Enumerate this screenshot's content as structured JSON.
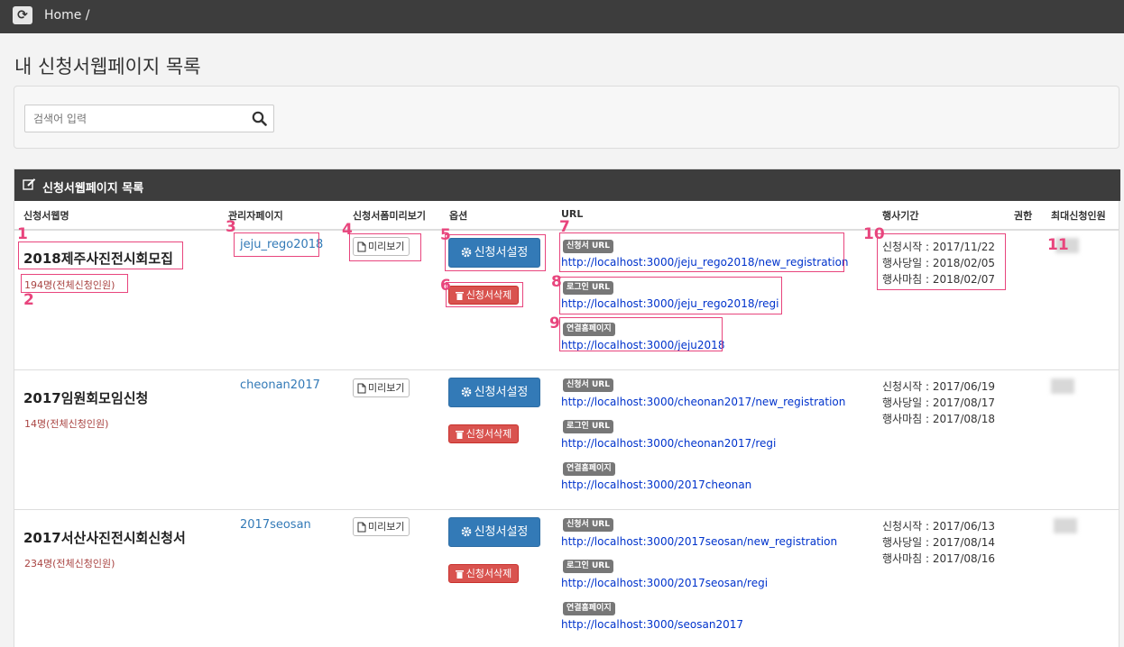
{
  "topbar": {
    "breadcrumb": "Home /",
    "refresh_glyph": "⟳"
  },
  "page": {
    "title": "내 신청서웹페이지 목록"
  },
  "search": {
    "placeholder": "검색어 입력"
  },
  "panel": {
    "title": "신청서웹페이지 목록"
  },
  "columns": {
    "name": "신청서웹명",
    "admin": "관리자페이지",
    "preview": "신청서폼미리보기",
    "options": "옵션",
    "url": "URL",
    "period": "행사기간",
    "permission": "권한",
    "max": "최대신청인원"
  },
  "common": {
    "preview_label": "미리보기",
    "settings_label": "신청서설정",
    "delete_label": "신청서삭제",
    "badge_form": "신청서 URL",
    "badge_login": "로그인 URL",
    "badge_home": "연결홈페이지"
  },
  "rows": [
    {
      "name": "2018제주사진전시회모집",
      "count": "194명(전체신청인원)",
      "admin": "jeju_rego2018",
      "form_url": "http://localhost:3000/jeju_rego2018/new_registration",
      "login_url": "http://localhost:3000/jeju_rego2018/regi",
      "home_url": "http://localhost:3000/jeju2018",
      "start": "신청시작 : 2017/11/22",
      "day": "행사당일 : 2018/02/05",
      "end": "행사마침 : 2018/02/07"
    },
    {
      "name": "2017임원회모임신청",
      "count": "14명(전체신청인원)",
      "admin": "cheonan2017",
      "form_url": "http://localhost:3000/cheonan2017/new_registration",
      "login_url": "http://localhost:3000/cheonan2017/regi",
      "home_url": "http://localhost:3000/2017cheonan",
      "start": "신청시작 : 2017/06/19",
      "day": "행사당일 : 2017/08/17",
      "end": "행사마침 : 2017/08/18"
    },
    {
      "name": "2017서산사진전시회신청서",
      "count": "234명(전체신청인원)",
      "admin": "2017seosan",
      "form_url": "http://localhost:3000/2017seosan/new_registration",
      "login_url": "http://localhost:3000/2017seosan/regi",
      "home_url": "http://localhost:3000/seosan2017",
      "start": "신청시작 : 2017/06/13",
      "day": "행사당일 : 2017/08/14",
      "end": "행사마침 : 2017/08/16"
    }
  ],
  "annotations": [
    "1",
    "2",
    "3",
    "4",
    "5",
    "6",
    "7",
    "8",
    "9",
    "10",
    "11"
  ],
  "colors": {
    "annotation": "#e8457d",
    "primary": "#337ab7",
    "danger": "#d9534f",
    "count": "#a94442"
  }
}
